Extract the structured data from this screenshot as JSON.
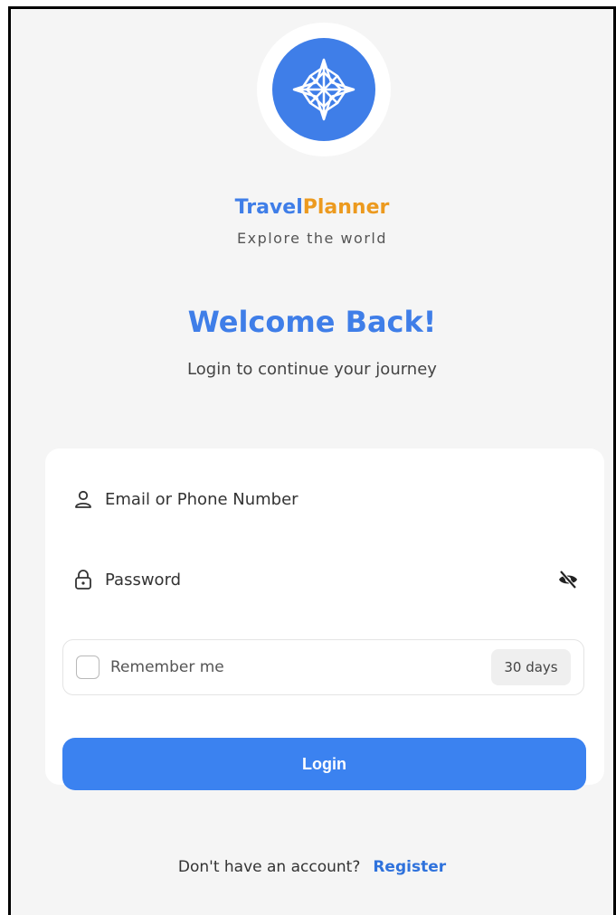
{
  "brand": {
    "name_part1": "Travel",
    "name_part2": "Planner",
    "tagline": "Explore the world",
    "logo_icon": "compass-icon",
    "colors": {
      "primary": "#3f7ee8",
      "accent": "#ec9a1f"
    }
  },
  "header": {
    "title": "Welcome Back!",
    "subtitle": "Login to continue your journey"
  },
  "form": {
    "email": {
      "placeholder": "Email or Phone Number",
      "icon": "user-icon"
    },
    "password": {
      "placeholder": "Password",
      "icon": "lock-icon",
      "toggle_icon": "eye-off-icon"
    },
    "remember": {
      "label": "Remember me",
      "checked": false,
      "badge": "30 days"
    },
    "submit_label": "Login"
  },
  "footer": {
    "prompt": "Don't have an account?",
    "link_label": "Register"
  }
}
